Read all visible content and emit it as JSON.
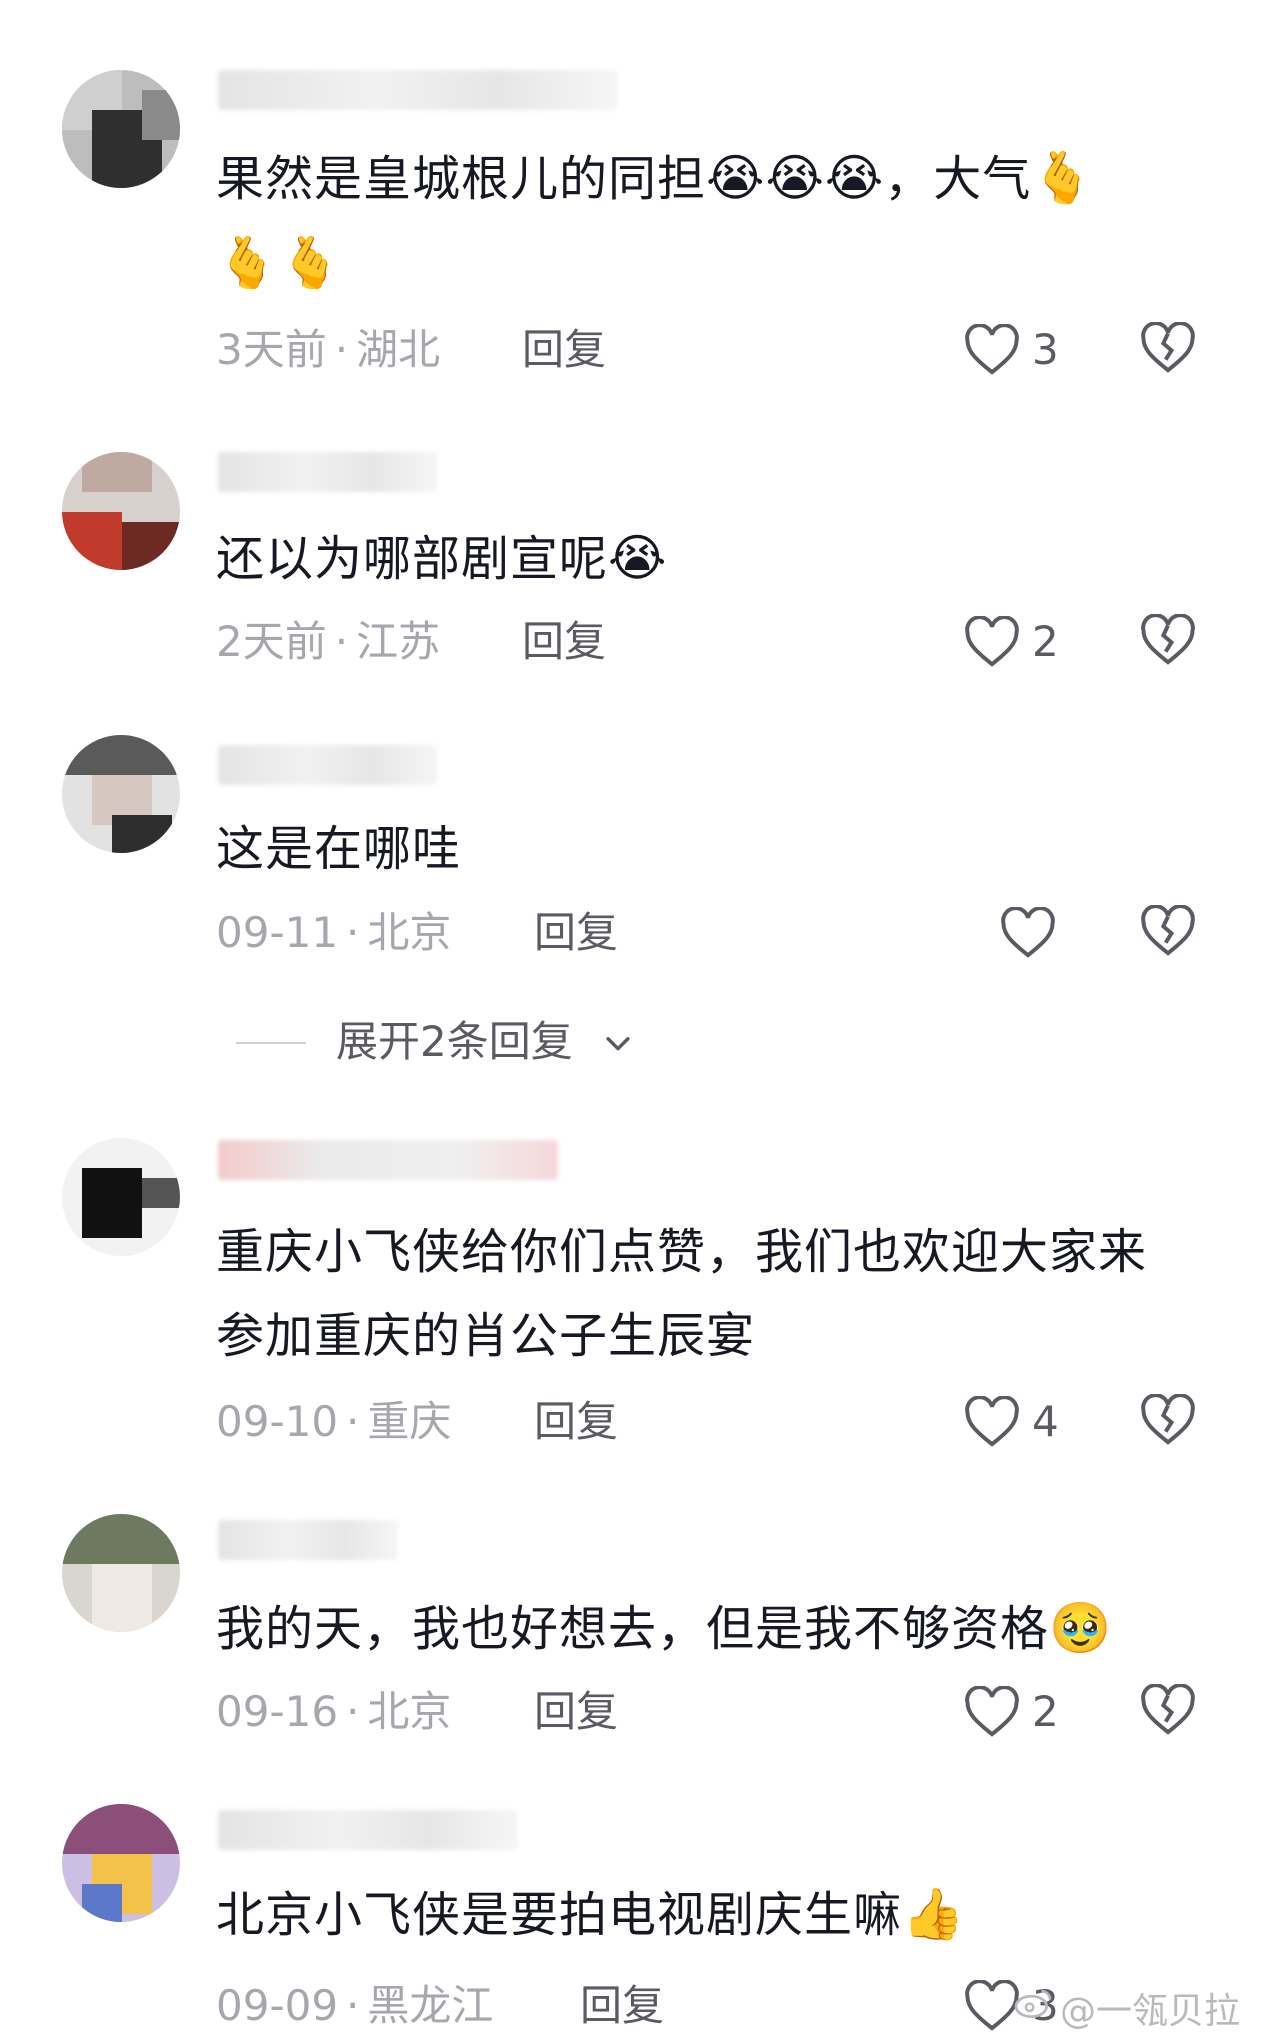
{
  "comments": [
    {
      "text": "果然是皇城根儿的同担",
      "emoji": "😭😭😭",
      "text_after": "，大气",
      "emoji_after": "🫰",
      "emoji_line2": "🫰🫰",
      "time": "3天前",
      "region": "湖北",
      "reply_label": "回复",
      "likes": "3"
    },
    {
      "text": "还以为哪部剧宣呢",
      "emoji": "😭",
      "time": "2天前",
      "region": "江苏",
      "reply_label": "回复",
      "likes": "2"
    },
    {
      "text": "这是在哪哇",
      "time": "09-11",
      "region": "北京",
      "reply_label": "回复",
      "likes": ""
    },
    {
      "text_line1": "重庆小飞侠给你们点赞，我们也欢迎大家来",
      "text_line2": "参加重庆的肖公子生辰宴",
      "time": "09-10",
      "region": "重庆",
      "reply_label": "回复",
      "likes": "4"
    },
    {
      "text": "我的天，我也好想去，但是我不够资格",
      "emoji": "🥹",
      "time": "09-16",
      "region": "北京",
      "reply_label": "回复",
      "likes": "2"
    },
    {
      "text": "北京小飞侠是要拍电视剧庆生嘛",
      "emoji": "👍",
      "time": "09-09",
      "region": "黑龙江",
      "reply_label": "回复",
      "likes": "3"
    }
  ],
  "expand_replies": {
    "label": "展开2条回复"
  },
  "watermark": {
    "text": "@一瓴贝拉"
  },
  "icons": {
    "like": "heart-outline-icon",
    "dislike": "broken-heart-icon",
    "expand": "chevron-down-icon"
  },
  "colors": {
    "text": "#161823",
    "meta": "#a6a6ad",
    "action": "#5a5a63"
  }
}
